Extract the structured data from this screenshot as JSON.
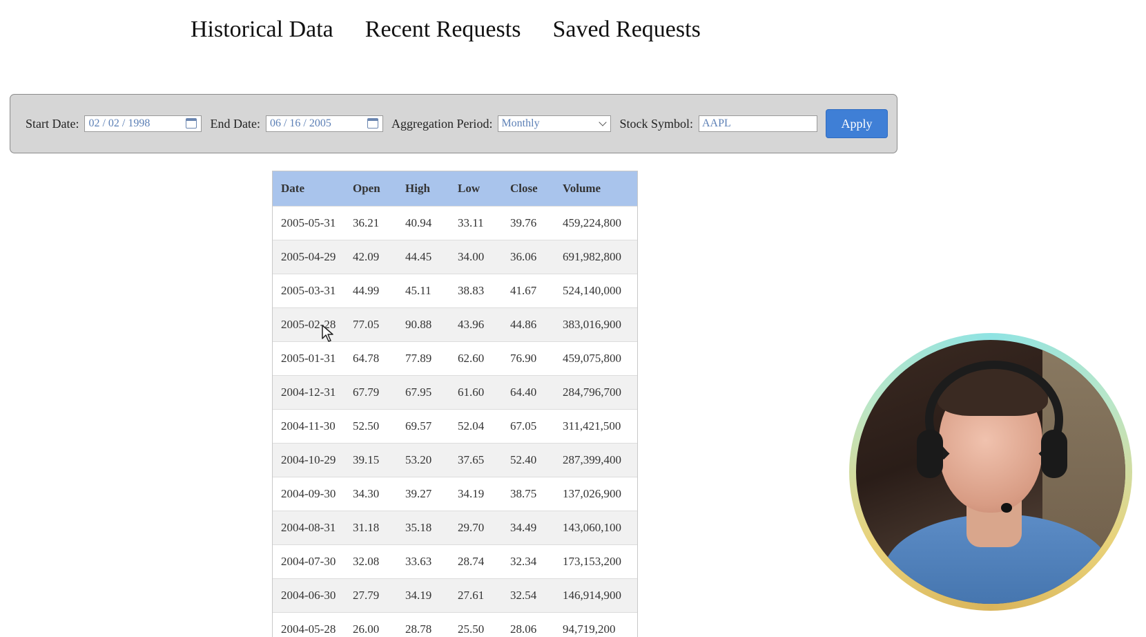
{
  "nav": {
    "links": [
      "Historical Data",
      "Recent Requests",
      "Saved Requests"
    ]
  },
  "filters": {
    "start_date_label": "Start Date:",
    "start_date_value": "02 / 02 / 1998",
    "end_date_label": "End Date:",
    "end_date_value": "06 / 16 / 2005",
    "aggregation_label": "Aggregation Period:",
    "aggregation_value": "Monthly",
    "symbol_label": "Stock Symbol:",
    "symbol_value": "AAPL",
    "apply_label": "Apply"
  },
  "table": {
    "columns": [
      "Date",
      "Open",
      "High",
      "Low",
      "Close",
      "Volume"
    ],
    "rows": [
      [
        "2005-05-31",
        "36.21",
        "40.94",
        "33.11",
        "39.76",
        "459,224,800"
      ],
      [
        "2005-04-29",
        "42.09",
        "44.45",
        "34.00",
        "36.06",
        "691,982,800"
      ],
      [
        "2005-03-31",
        "44.99",
        "45.11",
        "38.83",
        "41.67",
        "524,140,000"
      ],
      [
        "2005-02-28",
        "77.05",
        "90.88",
        "43.96",
        "44.86",
        "383,016,900"
      ],
      [
        "2005-01-31",
        "64.78",
        "77.89",
        "62.60",
        "76.90",
        "459,075,800"
      ],
      [
        "2004-12-31",
        "67.79",
        "67.95",
        "61.60",
        "64.40",
        "284,796,700"
      ],
      [
        "2004-11-30",
        "52.50",
        "69.57",
        "52.04",
        "67.05",
        "311,421,500"
      ],
      [
        "2004-10-29",
        "39.15",
        "53.20",
        "37.65",
        "52.40",
        "287,399,400"
      ],
      [
        "2004-09-30",
        "34.30",
        "39.27",
        "34.19",
        "38.75",
        "137,026,900"
      ],
      [
        "2004-08-31",
        "31.18",
        "35.18",
        "29.70",
        "34.49",
        "143,060,100"
      ],
      [
        "2004-07-30",
        "32.08",
        "33.63",
        "28.74",
        "32.34",
        "173,153,200"
      ],
      [
        "2004-06-30",
        "27.79",
        "34.19",
        "27.61",
        "32.54",
        "146,914,900"
      ],
      [
        "2004-05-28",
        "26.00",
        "28.78",
        "25.50",
        "28.06",
        "94,719,200"
      ]
    ]
  },
  "colors": {
    "header_bg": "#a9c4ec",
    "apply_bg": "#3f7fd6",
    "filter_bar_bg": "#d6d6d6"
  },
  "icons": {
    "calendar": "calendar-icon",
    "dropdown": "chevron-down-icon",
    "cursor": "cursor-icon"
  }
}
